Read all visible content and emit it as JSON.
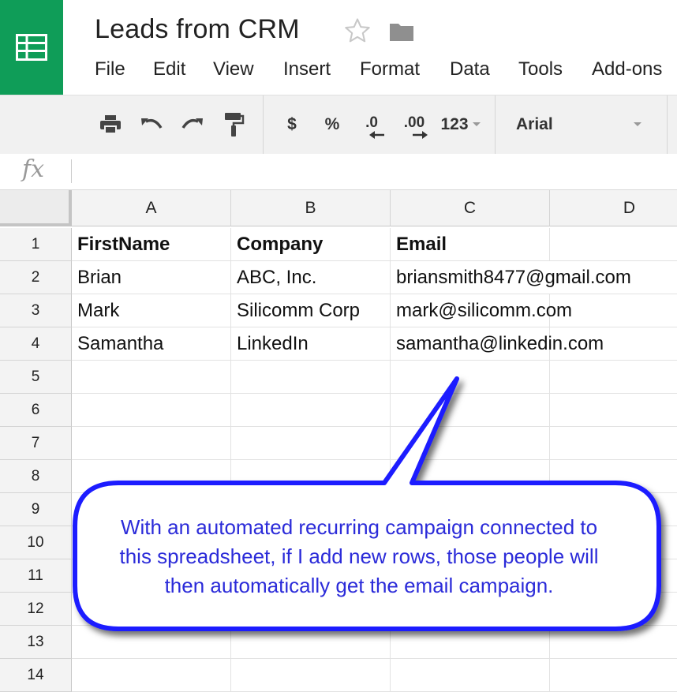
{
  "document": {
    "title": "Leads from CRM"
  },
  "icons": {
    "logo": "sheets-grid-icon",
    "star": "star-outline-icon",
    "folder": "folder-icon",
    "accent": "#0f9d58"
  },
  "menu": [
    "File",
    "Edit",
    "View",
    "Insert",
    "Format",
    "Data",
    "Tools",
    "Add-ons"
  ],
  "toolbar": {
    "currency": "$",
    "percent": "%",
    "decrease_decimal": ".0",
    "increase_decimal": ".00",
    "number_format": "123",
    "font": "Arial"
  },
  "formula_bar": {
    "fx_label": "fx",
    "value": ""
  },
  "sheet": {
    "columns": [
      "A",
      "B",
      "C",
      "D"
    ],
    "rows": [
      "1",
      "2",
      "3",
      "4",
      "5",
      "6",
      "7",
      "8",
      "9",
      "10",
      "11",
      "12",
      "13",
      "14"
    ],
    "cells": [
      [
        "FirstName",
        "Company",
        "Email"
      ],
      [
        "Brian",
        "ABC, Inc.",
        "briansmith8477@gmail.com"
      ],
      [
        "Mark",
        "Silicomm Corp",
        "mark@silicomm.com"
      ],
      [
        "Samantha",
        "LinkedIn",
        "samantha@linkedin.com"
      ]
    ]
  },
  "callout": {
    "lines": [
      "With an automated recurring campaign connected to",
      "this spreadsheet, if I add new rows, those people will",
      "then automatically get the email campaign."
    ],
    "color": "#1a1aff"
  }
}
